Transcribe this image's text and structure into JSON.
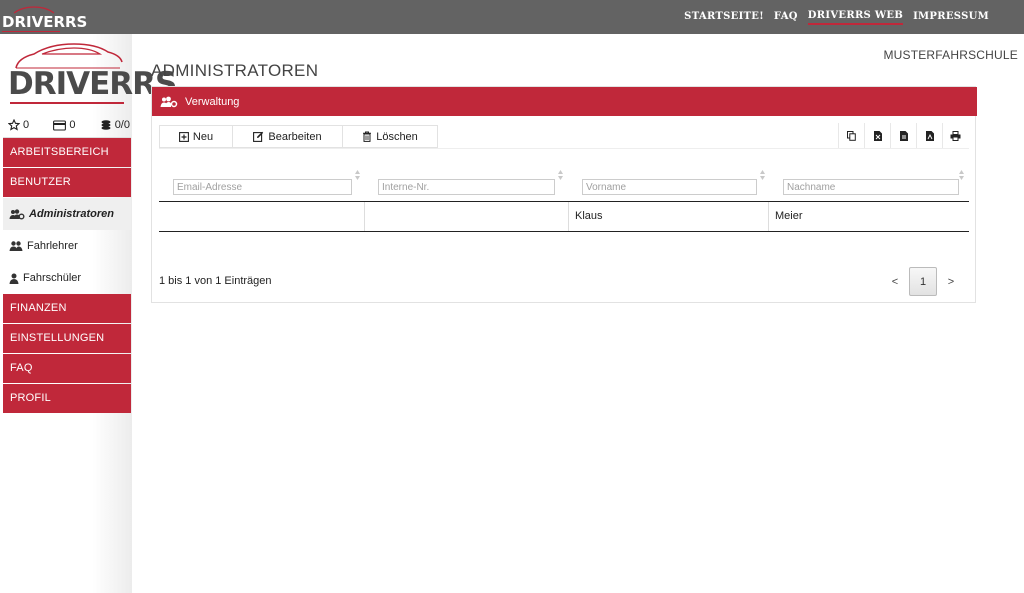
{
  "brand": {
    "name": "DRIVERRS",
    "accent": "#c0283a",
    "topbar_bg": "#636363"
  },
  "top_nav": [
    {
      "label": "STARTSEITE!",
      "active": false
    },
    {
      "label": "FAQ",
      "active": false
    },
    {
      "label": "DRIVERRS WEB",
      "active": true
    },
    {
      "label": "IMPRESSUM",
      "active": false
    }
  ],
  "school_name": "MUSTERFAHRSCHULE",
  "stats": {
    "stars": "0",
    "cards": "0",
    "coins": "0/0"
  },
  "sidebar": {
    "sections_top": [
      {
        "label": "ARBEITSBEREICH"
      },
      {
        "label": "BENUTZER"
      }
    ],
    "sub_items": [
      {
        "label": "Administratoren",
        "icon": "users-cog-icon",
        "active": true
      },
      {
        "label": "Fahrlehrer",
        "icon": "user-group-icon",
        "active": false
      },
      {
        "label": "Fahrschüler",
        "icon": "user-icon",
        "active": false
      }
    ],
    "sections_bottom": [
      {
        "label": "FINANZEN"
      },
      {
        "label": "EINSTELLUNGEN"
      },
      {
        "label": "FAQ"
      },
      {
        "label": "PROFIL"
      }
    ]
  },
  "page_title": "ADMINISTRATOREN",
  "panel": {
    "title": "Verwaltung",
    "buttons": {
      "new": "Neu",
      "edit": "Bearbeiten",
      "delete": "Löschen"
    },
    "export_icons": [
      "copy-icon",
      "excel-file-icon",
      "csv-file-icon",
      "pdf-file-icon",
      "print-icon"
    ]
  },
  "table": {
    "filters": {
      "email": "Email-Adresse",
      "internal": "Interne-Nr.",
      "firstname": "Vorname",
      "lastname": "Nachname"
    },
    "rows": [
      {
        "email": "",
        "internal": "",
        "firstname": "Klaus",
        "lastname": "Meier"
      }
    ]
  },
  "pagination": {
    "info": "1 bis 1 von 1 Einträgen",
    "prev": "<",
    "next": ">",
    "current": "1"
  }
}
